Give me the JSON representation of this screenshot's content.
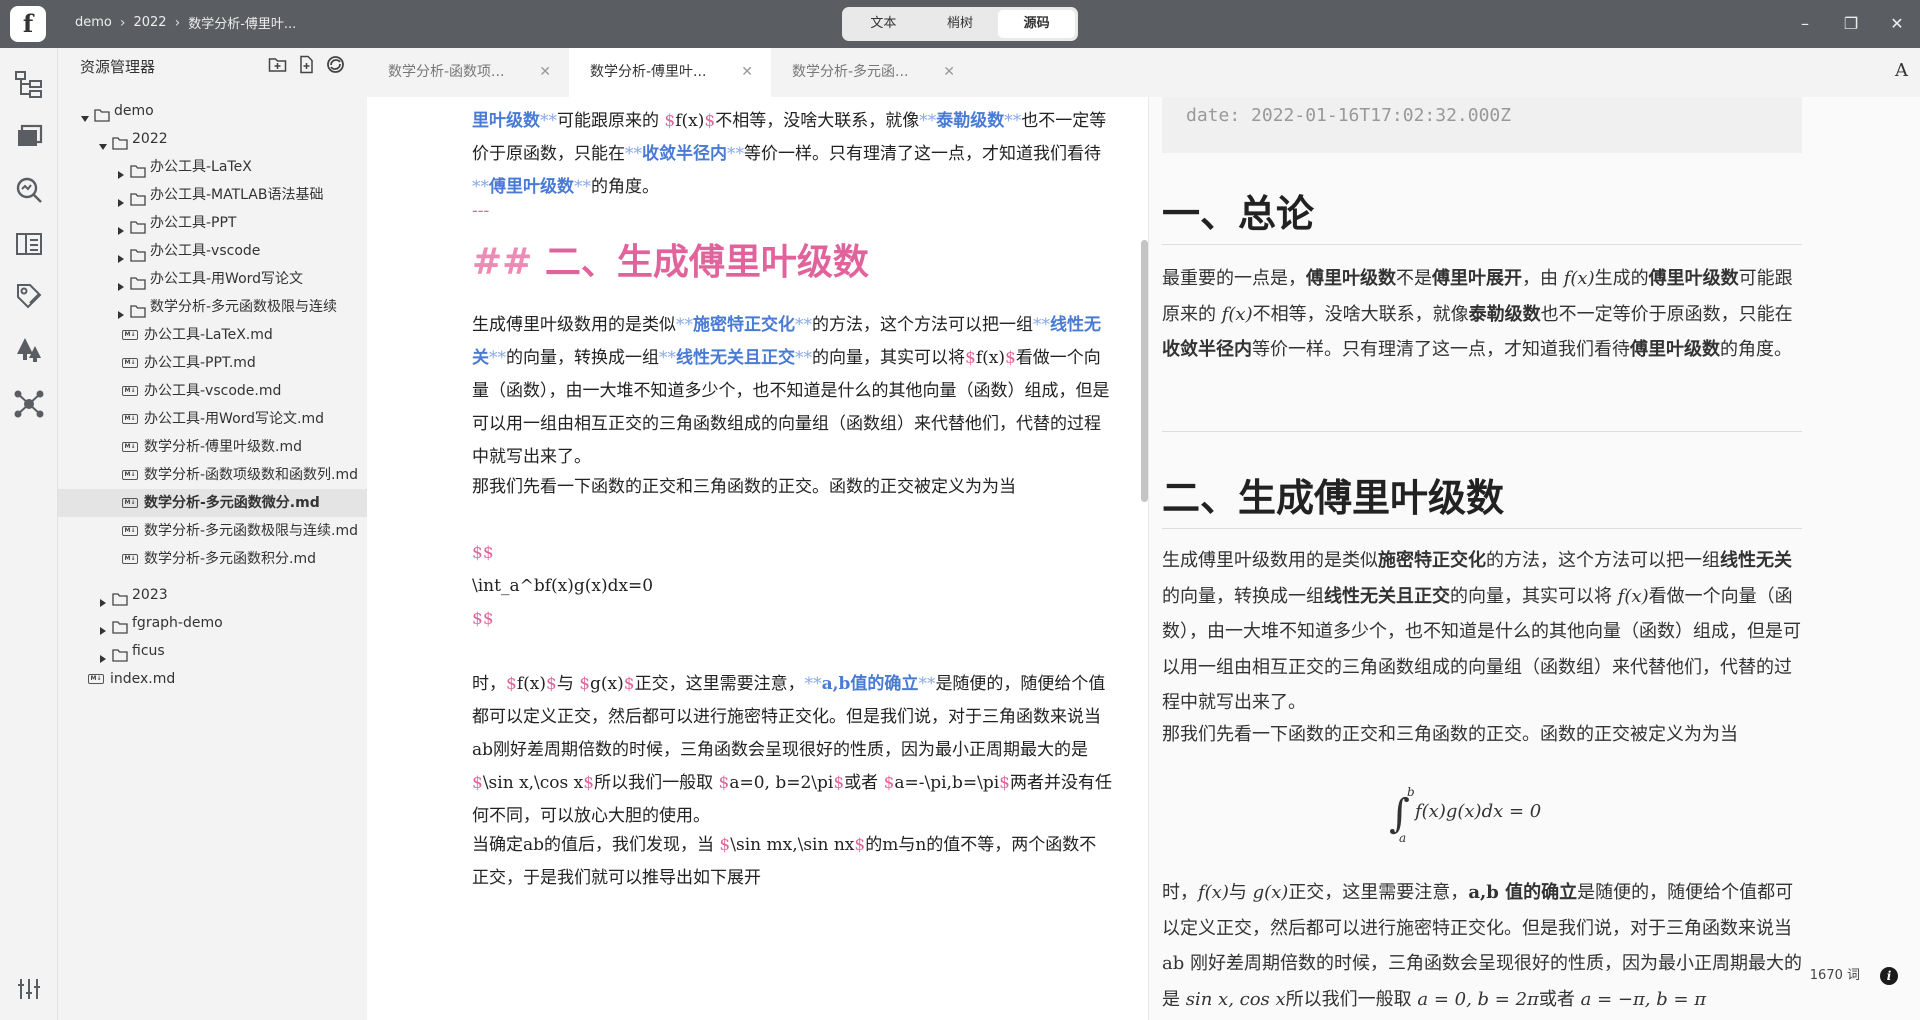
{
  "app": {
    "logo_letter": "f"
  },
  "breadcrumb": [
    "demo",
    "2022",
    "数学分析-傅里叶..."
  ],
  "modes": {
    "text": "文本",
    "outline": "梢树",
    "source": "源码"
  },
  "window_controls": {
    "minimize": "–",
    "maximize": "❐",
    "close": "✕"
  },
  "activity_bar": [
    "graph-icon",
    "files-icon",
    "search-icon",
    "outline-icon",
    "tags-icon",
    "tree-icon",
    "network-icon",
    "settings-icon"
  ],
  "sidebar": {
    "title": "资源管理器",
    "tree": [
      {
        "label": "demo",
        "type": "folder",
        "open": true,
        "depth": 0
      },
      {
        "label": "2022",
        "type": "folder",
        "open": true,
        "depth": 1
      },
      {
        "label": "办公工具-LaTeX",
        "type": "folder",
        "open": false,
        "depth": 2
      },
      {
        "label": "办公工具-MATLAB语法基础",
        "type": "folder",
        "open": false,
        "depth": 2
      },
      {
        "label": "办公工具-PPT",
        "type": "folder",
        "open": false,
        "depth": 2
      },
      {
        "label": "办公工具-vscode",
        "type": "folder",
        "open": false,
        "depth": 2
      },
      {
        "label": "办公工具-用Word写论文",
        "type": "folder",
        "open": false,
        "depth": 2
      },
      {
        "label": "数学分析-多元函数极限与连续",
        "type": "folder",
        "open": false,
        "depth": 2
      },
      {
        "label": "办公工具-LaTeX.md",
        "type": "file",
        "depth": 2
      },
      {
        "label": "办公工具-PPT.md",
        "type": "file",
        "depth": 2
      },
      {
        "label": "办公工具-vscode.md",
        "type": "file",
        "depth": 2
      },
      {
        "label": "办公工具-用Word写论文.md",
        "type": "file",
        "depth": 2
      },
      {
        "label": "数学分析-傅里叶级数.md",
        "type": "file",
        "depth": 2
      },
      {
        "label": "数学分析-函数项级数和函数列.md",
        "type": "file",
        "depth": 2
      },
      {
        "label": "数学分析-多元函数微分.md",
        "type": "file",
        "depth": 2,
        "selected": true
      },
      {
        "label": "数学分析-多元函数极限与连续.md",
        "type": "file",
        "depth": 2
      },
      {
        "label": "数学分析-多元函数积分.md",
        "type": "file",
        "depth": 2
      },
      {
        "label": "2023",
        "type": "folder",
        "open": false,
        "depth": 1
      },
      {
        "label": "fgraph-demo",
        "type": "folder",
        "open": false,
        "depth": 1
      },
      {
        "label": "ficus",
        "type": "folder",
        "open": false,
        "depth": 1
      },
      {
        "label": "index.md",
        "type": "file",
        "depth": 0
      }
    ]
  },
  "tabs": [
    {
      "label": "数学分析-函数项..."
    },
    {
      "label": "数学分析-傅里叶...",
      "active": true
    },
    {
      "label": "数学分析-多元函..."
    }
  ],
  "tab_font_button": "A",
  "editor": {
    "p1": [
      [
        "bl",
        "里叶级数"
      ],
      [
        "st",
        "**"
      ],
      [
        "",
        "可能跟原来的 "
      ],
      [
        "mt",
        "$"
      ],
      [
        "",
        "f(x)"
      ],
      [
        "mt",
        "$"
      ],
      [
        "",
        "不相等，没啥大联系，就像"
      ],
      [
        "st",
        "**"
      ],
      [
        "bl",
        "泰勒级数"
      ],
      [
        "st",
        "**"
      ],
      [
        "",
        "也不一定等价于原函数，只能在"
      ],
      [
        "st",
        "**"
      ],
      [
        "bl",
        "收敛半径内"
      ],
      [
        "st",
        "**"
      ],
      [
        "",
        "等价一样。只有理清了这一点，才知道我们看待"
      ],
      [
        "st",
        "**"
      ],
      [
        "bl",
        "傅里叶级数"
      ],
      [
        "st",
        "**"
      ],
      [
        "",
        "的角度。"
      ]
    ],
    "hr": "---",
    "heading_marks": "##",
    "heading": "二、生成傅里叶级数",
    "p2": [
      [
        "",
        "生成傅里叶级数用的是类似"
      ],
      [
        "st",
        "**"
      ],
      [
        "bl",
        "施密特正交化"
      ],
      [
        "st",
        "**"
      ],
      [
        "",
        "的方法，这个方法可以把一组"
      ],
      [
        "st",
        "**"
      ],
      [
        "bl",
        "线性无关"
      ],
      [
        "st",
        "**"
      ],
      [
        "",
        "的向量，转换成一组"
      ],
      [
        "st",
        "**"
      ],
      [
        "bl",
        "线性无关且正交"
      ],
      [
        "st",
        "**"
      ],
      [
        "",
        "的向量，其实可以将"
      ],
      [
        "mt",
        "$"
      ],
      [
        "",
        "f(x)"
      ],
      [
        "mt",
        "$"
      ],
      [
        "",
        "看做一个向量（函数），由一大堆不知道多少个，也不知道是什么的其他向量（函数）组成，但是可以用一组由相互正交的三角函数组成的向量组（函数组）来代替他们，代替的过程中就写出来了。"
      ]
    ],
    "p3": "那我们先看一下函数的正交和三角函数的正交。函数的正交被定义为为当",
    "math_open": "$$",
    "math_body": "\\int_a^bf(x)g(x)dx=0",
    "math_close": "$$",
    "p4": [
      [
        "",
        "时，"
      ],
      [
        "mt",
        "$"
      ],
      [
        "",
        "f(x)"
      ],
      [
        "mt",
        "$"
      ],
      [
        "",
        "与 "
      ],
      [
        "mt",
        "$"
      ],
      [
        "",
        "g(x)"
      ],
      [
        "mt",
        "$"
      ],
      [
        "",
        "正交，这里需要注意，"
      ],
      [
        "st",
        "**"
      ],
      [
        "bl",
        "a,b值的确立"
      ],
      [
        "st",
        "**"
      ],
      [
        "",
        "是随便的，随便给个值都可以定义正交，然后都可以进行施密特正交化。但是我们说，对于三角函数来说当ab刚好差周期倍数的时候，三角函数会呈现很好的性质，因为最小正周期最大的是 "
      ],
      [
        "mt",
        "$"
      ],
      [
        "",
        "\\sin x,\\cos x"
      ],
      [
        "mt",
        "$"
      ],
      [
        "",
        "所以我们一般取 "
      ],
      [
        "mt",
        "$"
      ],
      [
        "",
        "a=0, b=2\\pi"
      ],
      [
        "mt",
        "$"
      ],
      [
        "",
        "或者 "
      ],
      [
        "mt",
        "$"
      ],
      [
        "",
        "a=-\\pi,b=\\pi"
      ],
      [
        "mt",
        "$"
      ],
      [
        "",
        "两者并没有任何不同，可以放心大胆的使用。"
      ]
    ],
    "p5": [
      [
        "",
        "当确定ab的值后，我们发现，当 "
      ],
      [
        "mt",
        "$"
      ],
      [
        "",
        "\\sin mx,\\sin nx"
      ],
      [
        "mt",
        "$"
      ],
      [
        "",
        "的m与n的值不等，两个函数不正交，于是我们就可以推导出如下展开"
      ]
    ]
  },
  "preview": {
    "code": "date: 2022-01-16T17:02:32.000Z",
    "h1": "一、总论",
    "p1": [
      [
        "",
        "最重要的一点是，"
      ],
      [
        "b",
        "傅里叶级数"
      ],
      [
        "",
        "不是"
      ],
      [
        "b",
        "傅里叶展开"
      ],
      [
        "",
        "，由 "
      ],
      [
        "i",
        "f(x)"
      ],
      [
        "",
        "生成的"
      ],
      [
        "b",
        "傅里叶级数"
      ],
      [
        "",
        "可能跟原来的 "
      ],
      [
        "i",
        "f(x)"
      ],
      [
        "",
        "不相等，没啥大联系，就像"
      ],
      [
        "b",
        "泰勒级数"
      ],
      [
        "",
        "也不一定等价于原函数，只能在"
      ],
      [
        "b",
        "收敛半径内"
      ],
      [
        "",
        "等价一样。只有理清了这一点，才知道我们看待"
      ],
      [
        "b",
        "傅里叶级数"
      ],
      [
        "",
        "的角度。"
      ]
    ],
    "h2": "二、生成傅里叶级数",
    "p2": [
      [
        "",
        "生成傅里叶级数用的是类似"
      ],
      [
        "b",
        "施密特正交化"
      ],
      [
        "",
        "的方法，这个方法可以把一组"
      ],
      [
        "b",
        "线性无关"
      ],
      [
        "",
        "的向量，转换成一组"
      ],
      [
        "b",
        "线性无关且正交"
      ],
      [
        "",
        "的向量，其实可以将 "
      ],
      [
        "i",
        "f(x)"
      ],
      [
        "",
        "看做一个向量（函数），由一大堆不知道多少个，也不知道是什么的其他向量（函数）组成，但是可以用一组由相互正交的三角函数组成的向量组（函数组）来代替他们，代替的过程中就写出来了。"
      ]
    ],
    "p3": "那我们先看一下函数的正交和三角函数的正交。函数的正交被定义为为当",
    "eq_upper": "b",
    "eq_lower": "a",
    "eq_body": "f(x)g(x)dx = 0",
    "p4": [
      [
        "",
        "时，"
      ],
      [
        "i",
        "f(x)"
      ],
      [
        "",
        "与 "
      ],
      [
        "i",
        "g(x)"
      ],
      [
        "",
        "正交，这里需要注意，"
      ],
      [
        "b",
        "a,b 值的确立"
      ],
      [
        "",
        "是随便的，随便给个值都可以定义正交，然后都可以进行施密特正交化。但是我们说，对于三角函数来说当 ab 刚好差周期倍数的时候，三角函数会呈现很好的性质，因为最小正周期最大的是 "
      ],
      [
        "i",
        "sin x, cos x"
      ],
      [
        "",
        "所以我们一般取 "
      ],
      [
        "i",
        "a = 0, b = 2π"
      ],
      [
        "",
        "或者 "
      ],
      [
        "i",
        "a = −π, b = π"
      ]
    ]
  },
  "status": {
    "word_count": "1670 词",
    "info": "i"
  }
}
